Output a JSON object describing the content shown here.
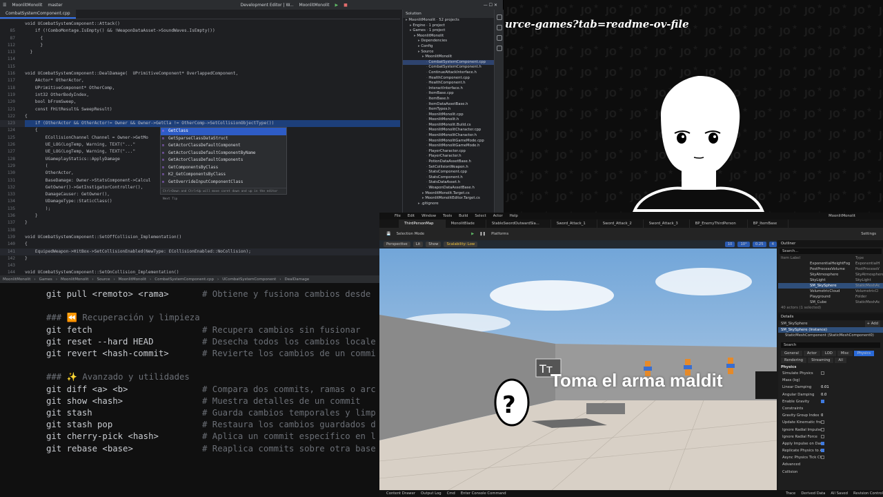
{
  "ide": {
    "project": "MoonlitMonolit",
    "branch": "master",
    "window_title": "Development Editor | W...",
    "run_config": "MoonlitMonolit",
    "tab": "CombatSystemComponent.cpp",
    "code_lines": [
      {
        "n": "",
        "t": "void UCombatSystemComponent::Attack()"
      },
      {
        "n": "85",
        "t": "    if (!ComboMontage.IsEmpty() && !WeaponDataAsset->SoundWaves.IsEmpty())"
      },
      {
        "n": "87",
        "t": "      {"
      },
      {
        "n": "112",
        "t": "      }"
      },
      {
        "n": "113",
        "t": "  }"
      },
      {
        "n": "114",
        "t": ""
      },
      {
        "n": "115",
        "t": ""
      },
      {
        "n": "116",
        "t": "void UCombatSystemComponent::DealDamage(  UPrimitiveComponent* OverlappedComponent,"
      },
      {
        "n": "117",
        "t": "    AActor* OtherActor,"
      },
      {
        "n": "118",
        "t": "    UPrimitiveComponent* OtherComp,"
      },
      {
        "n": "119",
        "t": "    int32 OtherBodyIndex,"
      },
      {
        "n": "120",
        "t": "    bool bFromSweep,"
      },
      {
        "n": "121",
        "t": "    const FHitResult& SweepResult)"
      },
      {
        "n": "122",
        "t": "{"
      },
      {
        "n": "123",
        "t": "    if (OtherActor && OtherActor!= Owner && Owner->GetCla != OtherComp->SetCollisionObjectType())"
      },
      {
        "n": "124",
        "t": "    {"
      },
      {
        "n": "125",
        "t": "        ECollisionChannel Channel = Owner->GetMo"
      },
      {
        "n": "126",
        "t": "        UE_LOG(LogTemp, Warning, TEXT(\"...\"                                              ));"
      },
      {
        "n": "127",
        "t": "        UE_LOG(LogTemp, Warning, TEXT(\"...\""
      },
      {
        "n": "128",
        "t": "        UGameplayStatics::ApplyDamage"
      },
      {
        "n": "129",
        "t": "        ("
      },
      {
        "n": "130",
        "t": "        OtherActor,"
      },
      {
        "n": "131",
        "t": "        BaseDamage: Owner->StatsComponent->Calcul"
      },
      {
        "n": "132",
        "t": "        GetOwner()->GetInstigatorController(),"
      },
      {
        "n": "133",
        "t": "        DamageCauser: GetOwner(),"
      },
      {
        "n": "134",
        "t": "        UDamageType::StaticClass()"
      },
      {
        "n": "135",
        "t": "        );"
      },
      {
        "n": "136",
        "t": "    }"
      },
      {
        "n": "137",
        "t": "}"
      },
      {
        "n": "138",
        "t": ""
      },
      {
        "n": "139",
        "t": "void UCombatSystemComponent::SetOffCollision_Implementation()"
      },
      {
        "n": "140",
        "t": "{"
      },
      {
        "n": "141",
        "t": "    EquipedWeapon->HitBox->SetCollisionEnabled(NewType: ECollisionEnabled::NoCollision);"
      },
      {
        "n": "142",
        "t": "}"
      },
      {
        "n": "143",
        "t": ""
      },
      {
        "n": "144",
        "t": "void UCombatSystemComponent::SetOnCollision_Implementation()"
      }
    ],
    "autocomplete": [
      "GetClass",
      "GetSparseClassDataStruct",
      "GetActorClassDefaultComponent",
      "GetActorClassDefaultComponentByName",
      "GetActorClassDefaultComponents",
      "GetComponentsByClass",
      "K2_GetComponentsByClass",
      "GetOverrideInputComponentClass"
    ],
    "autocomplete_hint": "Ctrl+Down and Ctrl+Up will move caret down and up in the editor  Next Tip",
    "solution_header": "Solution",
    "solution_tree": [
      {
        "l": "MoonlitMonolit · 52 projects",
        "d": 0
      },
      {
        "l": "Engine · 1 project",
        "d": 1
      },
      {
        "l": "Games · 1 project",
        "d": 1
      },
      {
        "l": "MoonlitMonolit",
        "d": 2
      },
      {
        "l": "Dependencies",
        "d": 3
      },
      {
        "l": "Config",
        "d": 3
      },
      {
        "l": "Source",
        "d": 3
      },
      {
        "l": "MoonlitMonolit",
        "d": 4
      },
      {
        "l": "CombatSystemComponent.cpp",
        "d": 5,
        "sel": true
      },
      {
        "l": "CombatSystemComponent.h",
        "d": 5
      },
      {
        "l": "ContinueAttackInterface.h",
        "d": 5
      },
      {
        "l": "HealthComponent.cpp",
        "d": 5
      },
      {
        "l": "HealthComponent.h",
        "d": 5
      },
      {
        "l": "InteractInterface.h",
        "d": 5
      },
      {
        "l": "ItemBase.cpp",
        "d": 5
      },
      {
        "l": "ItemBase.h",
        "d": 5
      },
      {
        "l": "ItemDataAssetBase.h",
        "d": 5
      },
      {
        "l": "ItemTypes.h",
        "d": 5
      },
      {
        "l": "MoonlitMonolit.cpp",
        "d": 5
      },
      {
        "l": "MoonlitMonolit.h",
        "d": 5
      },
      {
        "l": "MoonlitMonolit.Build.cs",
        "d": 5
      },
      {
        "l": "MoonlitMonolitCharacter.cpp",
        "d": 5
      },
      {
        "l": "MoonlitMonolitCharacter.h",
        "d": 5
      },
      {
        "l": "MoonlitMonolitGameMode.cpp",
        "d": 5
      },
      {
        "l": "MoonlitMonolitGameMode.h",
        "d": 5
      },
      {
        "l": "PlayerCharacter.cpp",
        "d": 5
      },
      {
        "l": "PlayerCharacter.h",
        "d": 5
      },
      {
        "l": "PotionDataAssetBase.h",
        "d": 5
      },
      {
        "l": "SetCollisionWeapon.h",
        "d": 5
      },
      {
        "l": "StatsComponent.cpp",
        "d": 5
      },
      {
        "l": "StatsComponent.h",
        "d": 5
      },
      {
        "l": "StatsDataAsset.h",
        "d": 5
      },
      {
        "l": "WeaponDataAssetBase.h",
        "d": 5
      },
      {
        "l": "MoonlitMonolit.Target.cs",
        "d": 4
      },
      {
        "l": "MoonlitMonolitEditor.Target.cs",
        "d": 4
      },
      {
        "l": ".gitignore",
        "d": 3
      }
    ],
    "breadcrumb": [
      "MoonlitMonolit",
      "Games",
      "MoonlitMonolit",
      "Source",
      "MoonlitMonolit",
      "CombatSystemComponent.cpp",
      "UCombatSystemComponent",
      "DealDamage"
    ]
  },
  "terminal": {
    "rows": [
      {
        "cmd": "git pull <remoto> <rama>",
        "desc": "# Obtiene y fusiona cambios desde"
      },
      {
        "cmd": "",
        "desc": ""
      },
      {
        "section": "### ⏪ Recuperación y limpieza"
      },
      {
        "cmd": "git fetch",
        "desc": "# Recupera cambios sin fusionar"
      },
      {
        "cmd": "git reset --hard HEAD",
        "desc": "# Desecha todos los cambios locale"
      },
      {
        "cmd": "git revert <hash-commit>",
        "desc": "# Revierte los cambios de un commi"
      },
      {
        "cmd": "",
        "desc": ""
      },
      {
        "section": "### ✨ Avanzado y utilidades"
      },
      {
        "cmd": "git diff <a> <b>",
        "desc": "# Compara dos commits, ramas o arc"
      },
      {
        "cmd": "git show <hash>",
        "desc": "# Muestra detalles de un commit"
      },
      {
        "cmd": "git stash",
        "desc": "# Guarda cambios temporales y limp"
      },
      {
        "cmd": "git stash pop",
        "desc": "# Restaura los cambios guardados d"
      },
      {
        "cmd": "git cherry-pick <hash>",
        "desc": "# Aplica un commit específico en l"
      },
      {
        "cmd": "git rebase <base>",
        "desc": "# Reaplica commits sobre otra base"
      }
    ]
  },
  "stream": {
    "url_text": "urce-games?tab=readme-ov-file"
  },
  "unreal": {
    "menu": [
      "File",
      "Edit",
      "Window",
      "Tools",
      "Build",
      "Select",
      "Actor",
      "Help"
    ],
    "title": "MoonlitMonolit",
    "tabs": [
      "ThirdPersonMap",
      "MonolitBlade",
      "StableSwordOutwardSla...",
      "Sword_Attack_1",
      "Sword_Attack_2",
      "Sword_Attack_3",
      "BP_EnemyThirdPerson",
      "BP_ItemBase"
    ],
    "selection_mode": "Selection Mode",
    "platforms": "Platforms",
    "settings": "Settings",
    "viewport_chips": [
      "Perspective",
      "Lit",
      "Show",
      "Scalability: Low"
    ],
    "viewport_nums": [
      "10",
      "10°",
      "0.25",
      "4"
    ],
    "world_text": "Toma el arma maldit",
    "outliner": {
      "title": "Outliner",
      "search": "Search...",
      "cols": [
        "Item Label",
        "Type"
      ],
      "rows": [
        {
          "l": "ExponentialHeightFog",
          "t": "ExponentialH"
        },
        {
          "l": "PostProcessVolume",
          "t": "PostProcessV"
        },
        {
          "l": "SkyAtmosphere",
          "t": "SkyAtmosphere"
        },
        {
          "l": "SkyLight",
          "t": "SkyLight"
        },
        {
          "l": "SM_SkySphere",
          "t": "StaticMeshAc",
          "sel": true
        },
        {
          "l": "VolumetricCloud",
          "t": "VolumetricCl"
        },
        {
          "l": "Playground",
          "t": "Folder"
        },
        {
          "l": "SM_Cube",
          "t": "StaticMeshAc"
        }
      ],
      "count": "40 actors (1 selected)"
    },
    "details": {
      "title": "Details",
      "object": "SM_SkySphere",
      "add": "+ Add",
      "instance": "SM_SkySphere (Instance)",
      "component": "StaticMeshComponent (StaticMeshComponent0)",
      "search": "Search",
      "filters": [
        "General",
        "Actor",
        "LOD",
        "Misc",
        "Physics",
        "Rendering",
        "Streaming",
        "All"
      ],
      "section": "Physics",
      "props": [
        {
          "k": "Simulate Physics",
          "v": "",
          "c": "off"
        },
        {
          "k": "Mass (kg)",
          "v": "",
          "c": "none"
        },
        {
          "k": "Linear Damping",
          "v": "0.01",
          "c": "none"
        },
        {
          "k": "Angular Damping",
          "v": "0.0",
          "c": "none"
        },
        {
          "k": "Enable Gravity",
          "v": "",
          "c": "on"
        },
        {
          "k": "Constraints",
          "v": "",
          "c": "none"
        },
        {
          "k": "Gravity Group Index",
          "v": "0",
          "c": "none"
        },
        {
          "k": "Update Kinematic from",
          "v": "",
          "c": "off"
        },
        {
          "k": "Ignore Radial Impulse",
          "v": "",
          "c": "off"
        },
        {
          "k": "Ignore Radial Force",
          "v": "",
          "c": "off"
        },
        {
          "k": "Apply Impulse on Dama",
          "v": "",
          "c": "on"
        },
        {
          "k": "Replicate Physics to A",
          "v": "",
          "c": "on"
        },
        {
          "k": "Async Physics Tick Ch",
          "v": "",
          "c": "off"
        },
        {
          "k": "Advanced",
          "v": "",
          "c": "none"
        },
        {
          "k": "Collision",
          "v": "",
          "c": "none"
        }
      ]
    },
    "bottom": [
      "Content Drawer",
      "Output Log",
      "Cmd",
      "Enter Console Command"
    ],
    "bottom_right": [
      "Trace",
      "Derived Data",
      "All Saved",
      "Revision Control"
    ]
  }
}
